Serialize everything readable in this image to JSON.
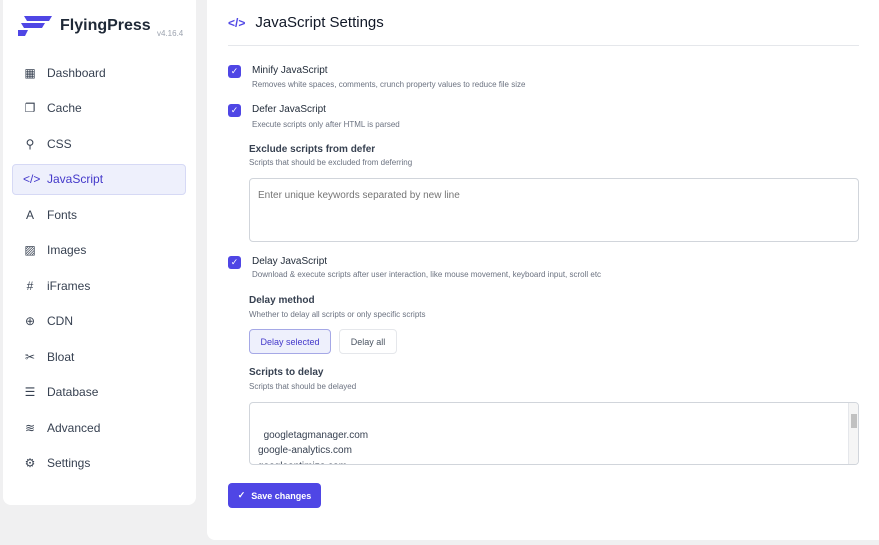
{
  "app": {
    "name": "FlyingPress",
    "version": "v4.16.4",
    "brand_color": "#4f46e5"
  },
  "sidebar": {
    "items": [
      {
        "label": "Dashboard",
        "icon": "grid-icon",
        "glyph": "▦"
      },
      {
        "label": "Cache",
        "icon": "copy-icon",
        "glyph": "❐"
      },
      {
        "label": "CSS",
        "icon": "paint-roller-icon",
        "glyph": "⚲"
      },
      {
        "label": "JavaScript",
        "icon": "code-icon",
        "glyph": "</>",
        "active": true
      },
      {
        "label": "Fonts",
        "icon": "font-icon",
        "glyph": "A"
      },
      {
        "label": "Images",
        "icon": "image-icon",
        "glyph": "▨"
      },
      {
        "label": "iFrames",
        "icon": "hash-icon",
        "glyph": "#"
      },
      {
        "label": "CDN",
        "icon": "globe-icon",
        "glyph": "⊕"
      },
      {
        "label": "Bloat",
        "icon": "scissors-icon",
        "glyph": "✂"
      },
      {
        "label": "Database",
        "icon": "database-icon",
        "glyph": "☰"
      },
      {
        "label": "Advanced",
        "icon": "sliders-icon",
        "glyph": "≋"
      },
      {
        "label": "Settings",
        "icon": "gear-icon",
        "glyph": "⚙"
      }
    ]
  },
  "main": {
    "title": "JavaScript Settings",
    "minify": {
      "label": "Minify JavaScript",
      "desc": "Removes white spaces, comments, crunch property values to reduce file size",
      "checked": true
    },
    "defer": {
      "label": "Defer JavaScript",
      "desc": "Execute scripts only after HTML is parsed",
      "checked": true
    },
    "exclude": {
      "label": "Exclude scripts from defer",
      "desc": "Scripts that should be excluded from deferring",
      "placeholder": "Enter unique keywords separated by new line"
    },
    "delay": {
      "label": "Delay JavaScript",
      "desc": "Download & execute scripts after user interaction, like mouse movement, keyboard input, scroll etc",
      "checked": true
    },
    "method": {
      "label": "Delay method",
      "desc": "Whether to delay all scripts or only specific scripts",
      "options": [
        "Delay selected",
        "Delay all"
      ],
      "selected": "Delay selected"
    },
    "scripts": {
      "label": "Scripts to delay",
      "desc": "Scripts that should be delayed",
      "value": "googletagmanager.com\ngoogle-analytics.com\ngoogleoptimize.com\nadsbygoogle.js"
    },
    "save_label": "Save changes"
  }
}
